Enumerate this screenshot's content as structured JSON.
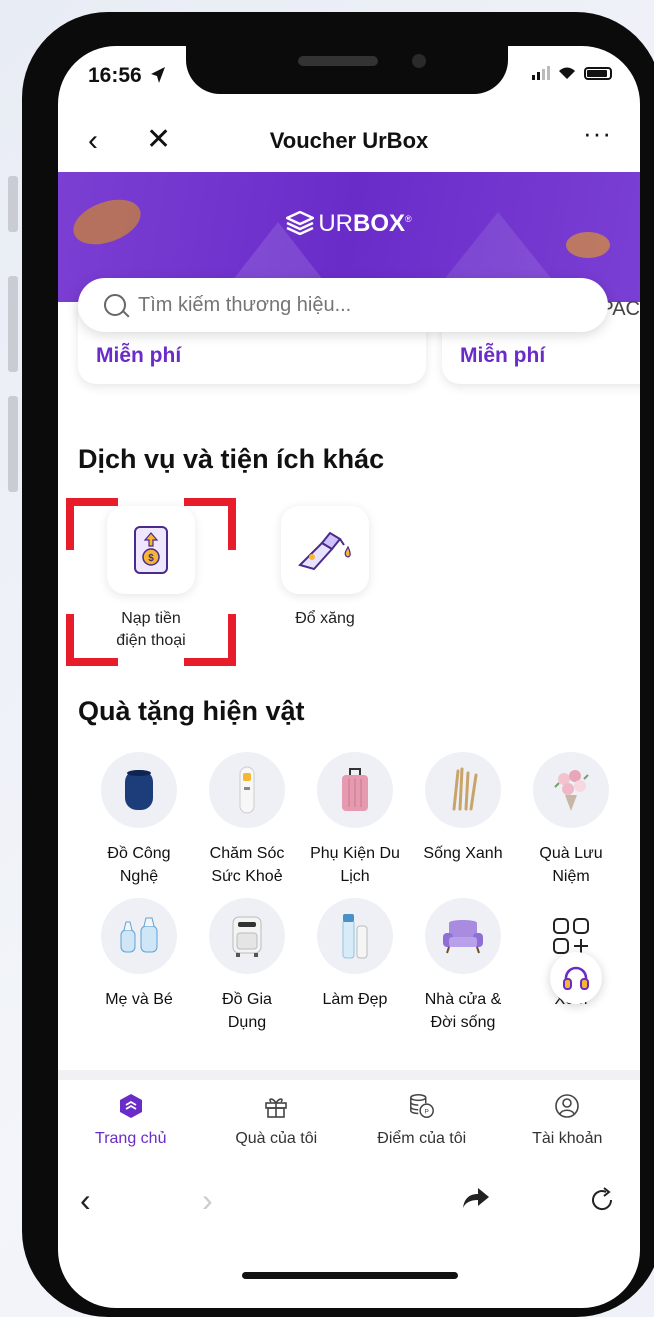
{
  "status": {
    "time": "16:56"
  },
  "nav": {
    "back": "‹",
    "close": "✕",
    "title": "Voucher UrBox",
    "more": "···"
  },
  "banner": {
    "logo_prefix": "UR",
    "logo_bold": "BOX",
    "logo_mark": "®"
  },
  "search": {
    "placeholder": "Tìm kiếm thương hiệu...",
    "peek_text": "PAC"
  },
  "voucher_cards": [
    {
      "label": "Miễn phí"
    },
    {
      "label": "Miễn phí"
    }
  ],
  "services": {
    "title": "Dịch vụ và tiện ích khác",
    "items": [
      {
        "label_line1": "Nạp tiền",
        "label_line2": "điện thoại",
        "icon": "phone-topup-icon",
        "highlighted": true
      },
      {
        "label_line1": "Đổ xăng",
        "label_line2": "",
        "icon": "fuel-nozzle-icon",
        "highlighted": false
      }
    ]
  },
  "gifts": {
    "title": "Quà tặng hiện vật",
    "items": [
      {
        "line1": "Đồ Công",
        "line2": "Nghệ",
        "icon": "speaker-icon"
      },
      {
        "line1": "Chăm Sóc",
        "line2": "Sức Khoẻ",
        "icon": "thermometer-icon"
      },
      {
        "line1": "Phụ Kiện Du",
        "line2": "Lịch",
        "icon": "suitcase-icon"
      },
      {
        "line1": "Sống Xanh",
        "line2": "",
        "icon": "bamboo-straws-icon"
      },
      {
        "line1": "Quà Lưu",
        "line2": "Niệm",
        "icon": "flower-bouquet-icon"
      },
      {
        "line1": "Mẹ và Bé",
        "line2": "",
        "icon": "baby-bottle-icon"
      },
      {
        "line1": "Đồ Gia",
        "line2": "Dụng",
        "icon": "air-fryer-icon"
      },
      {
        "line1": "Làm Đẹp",
        "line2": "",
        "icon": "cosmetics-icon"
      },
      {
        "line1": "Nhà cửa &",
        "line2": "Đời sống",
        "icon": "armchair-icon"
      },
      {
        "line1": "Xem",
        "line2": "",
        "icon": "grid-plus-icon"
      }
    ]
  },
  "tabs": [
    {
      "label": "Trang chủ",
      "icon": "home-logo-icon",
      "active": true
    },
    {
      "label": "Quà của tôi",
      "icon": "gift-icon",
      "active": false
    },
    {
      "label": "Điểm của tôi",
      "icon": "coins-icon",
      "active": false
    },
    {
      "label": "Tài khoản",
      "icon": "account-icon",
      "active": false
    }
  ],
  "browser": {
    "back": "‹",
    "forward": "›"
  },
  "colors": {
    "brand": "#6a2cc9",
    "highlight": "#e81d2b",
    "banner": "#7b3fd3"
  }
}
